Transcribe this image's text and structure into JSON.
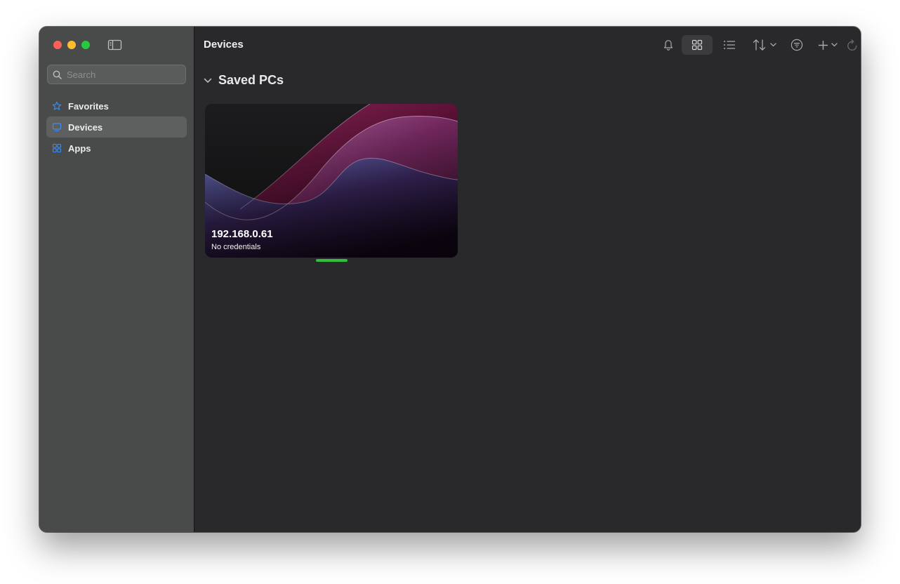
{
  "sidebar": {
    "search": {
      "placeholder": "Search",
      "value": ""
    },
    "items": [
      {
        "label": "Favorites",
        "icon": "star-icon",
        "active": false
      },
      {
        "label": "Devices",
        "icon": "monitor-icon",
        "active": true
      },
      {
        "label": "Apps",
        "icon": "apps-icon",
        "active": false
      }
    ]
  },
  "header": {
    "title": "Devices",
    "toolbar": {
      "icons": [
        "bell-icon",
        "grid-view-icon",
        "list-view-icon",
        "sort-icon",
        "filter-icon",
        "add-icon",
        "refresh-icon"
      ],
      "selected_view": "grid"
    }
  },
  "section": {
    "title": "Saved PCs",
    "expanded": true
  },
  "devices": [
    {
      "name": "192.168.0.61",
      "subtitle": "No credentials"
    }
  ],
  "colors": {
    "accent": "#3d8cf0",
    "status_connected": "#2fbf3a",
    "sidebar_bg": "#494a4a",
    "main_bg": "#29292b"
  }
}
